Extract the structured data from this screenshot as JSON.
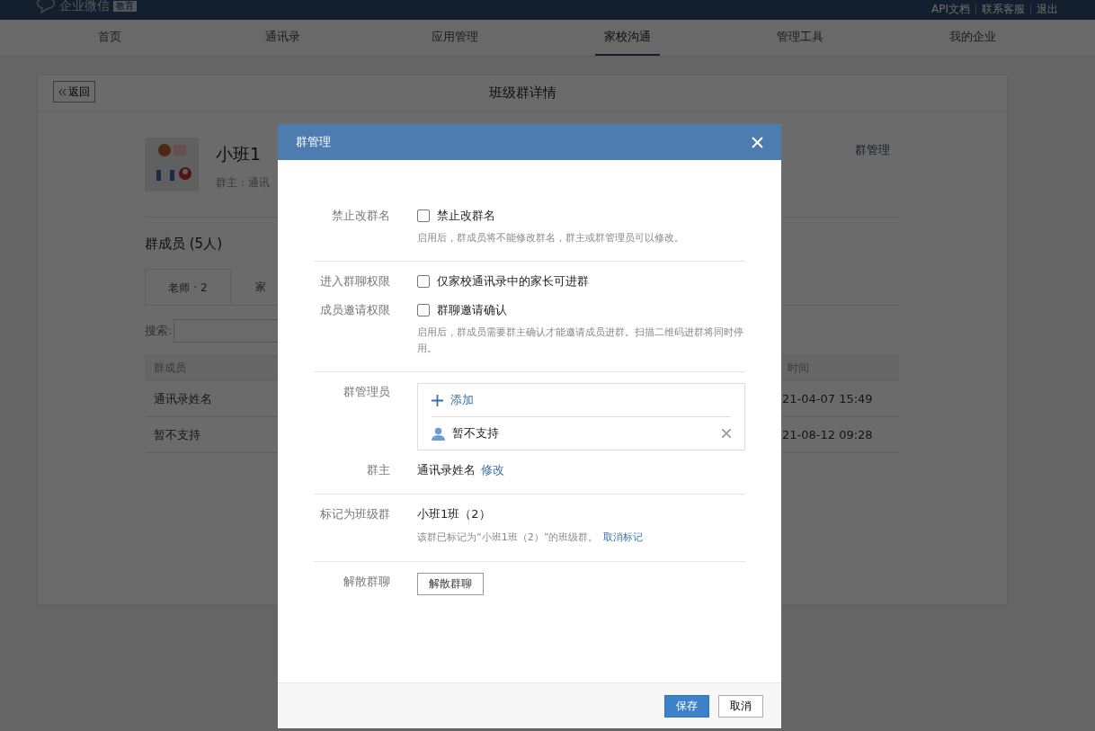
{
  "top_bar": {
    "logo": "企业微信",
    "badge": "教育",
    "links": [
      "API文档",
      "联系客服",
      "退出"
    ]
  },
  "nav": [
    {
      "label": "首页",
      "selected": false
    },
    {
      "label": "通讯录",
      "selected": false
    },
    {
      "label": "应用管理",
      "selected": false
    },
    {
      "label": "家校沟通",
      "selected": true
    },
    {
      "label": "管理工具",
      "selected": false
    },
    {
      "label": "我的企业",
      "selected": false
    }
  ],
  "page": {
    "back_button": "返回",
    "title": "班级群详情",
    "group_name": "小班1",
    "owner_line": "群主：通讯",
    "manage_link": "群管理",
    "members_heading": "群成员 (5人)",
    "tabs": [
      {
        "label": "老师 · 2",
        "selected": true
      },
      {
        "label": "家",
        "selected": false
      }
    ],
    "search_label": "搜索:",
    "table": {
      "columns": [
        "群成员",
        "时间"
      ],
      "rows": [
        [
          "通讯录姓名",
          "21-04-07 15:49"
        ],
        [
          "暂不支持",
          "21-08-12 09:28"
        ]
      ]
    }
  },
  "dialog": {
    "title": "群管理",
    "sections": [
      [
        {
          "kind": "checkbox",
          "label": "禁止改群名",
          "option": "禁止改群名",
          "checked": false,
          "hint": "启用后，群成员将不能修改群名，群主或群管理员可以修改。"
        }
      ],
      [
        {
          "kind": "checkbox",
          "label": "进入群聊权限",
          "option": "仅家校通讯录中的家长可进群",
          "checked": false
        },
        {
          "kind": "checkbox",
          "label": "成员邀请权限",
          "option": "群聊邀请确认",
          "checked": false,
          "hint": "启用后，群成员需要群主确认才能邀请成员进群。扫描二维码进群将同时停用。"
        }
      ],
      [
        {
          "kind": "admins",
          "label": "群管理员",
          "add": "添加",
          "members": [
            "暂不支持"
          ]
        },
        {
          "kind": "owner",
          "label": "群主",
          "value": "通讯录姓名",
          "link": "修改"
        }
      ],
      [
        {
          "kind": "class",
          "label": "标记为班级群",
          "value": "小班1班（2）",
          "hint": "该群已标记为“小班1班（2）”的班级群。",
          "link": "取消标记"
        }
      ],
      [
        {
          "kind": "button",
          "label": "解散群聊",
          "button": "解散群聊"
        }
      ]
    ],
    "buttons": [
      {
        "label": "保存",
        "kind": "primary"
      },
      {
        "label": "取消",
        "kind": "default"
      }
    ]
  }
}
